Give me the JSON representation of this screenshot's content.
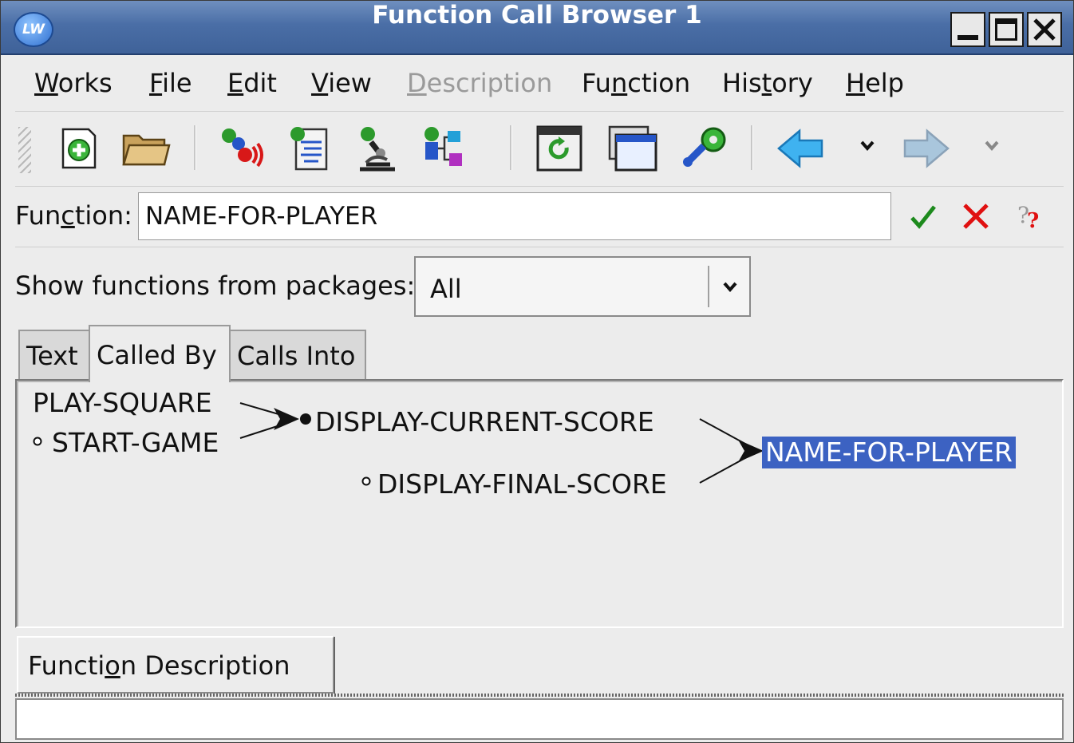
{
  "window": {
    "title": "Function Call Browser 1",
    "app_icon": "LW",
    "controls": [
      "minimize-icon",
      "maximize-icon",
      "close-icon"
    ]
  },
  "menu": {
    "items": [
      {
        "label": "Works",
        "mnemonic_index": 0,
        "enabled": true
      },
      {
        "label": "File",
        "mnemonic_index": 0,
        "enabled": true
      },
      {
        "label": "Edit",
        "mnemonic_index": 0,
        "enabled": true
      },
      {
        "label": "View",
        "mnemonic_index": 0,
        "enabled": true
      },
      {
        "label": "Description",
        "mnemonic_index": 0,
        "enabled": false
      },
      {
        "label": "Function",
        "mnemonic_index": 2,
        "enabled": true
      },
      {
        "label": "History",
        "mnemonic_index": 3,
        "enabled": true
      },
      {
        "label": "Help",
        "mnemonic_index": 0,
        "enabled": true
      }
    ]
  },
  "toolbar": {
    "buttons": [
      "new-window-icon",
      "open-folder-icon",
      "listener-icon",
      "editor-icon",
      "inspector-icon",
      "class-browser-icon",
      "refresh-icon",
      "window-icon",
      "tools-icon",
      "back-arrow-icon",
      "forward-arrow-icon"
    ]
  },
  "function_row": {
    "label": "Function:",
    "mnemonic_index": 3,
    "value": "NAME-FOR-PLAYER",
    "icons": [
      "accept-check-icon",
      "cancel-x-icon",
      "help-question-icon"
    ]
  },
  "packages_row": {
    "label": "Show functions from packages:",
    "selected": "All"
  },
  "tabs": [
    {
      "label": "Text",
      "active": false
    },
    {
      "label": "Called By",
      "active": true
    },
    {
      "label": "Calls Into",
      "active": false
    }
  ],
  "graph": {
    "nodes": [
      {
        "id": "play-square",
        "label": "PLAY-SQUARE",
        "expanded": false
      },
      {
        "id": "start-game",
        "label": "START-GAME",
        "expanded": true
      },
      {
        "id": "display-current-score",
        "label": "DISPLAY-CURRENT-SCORE",
        "expanded": false
      },
      {
        "id": "display-final-score",
        "label": "DISPLAY-FINAL-SCORE",
        "expanded": true
      },
      {
        "id": "name-for-player",
        "label": "NAME-FOR-PLAYER",
        "selected": true
      }
    ],
    "edges": [
      {
        "from": "play-square",
        "to": "display-current-score"
      },
      {
        "from": "start-game",
        "to": "display-current-score"
      },
      {
        "from": "display-current-score",
        "to": "name-for-player"
      },
      {
        "from": "display-final-score",
        "to": "name-for-player"
      }
    ]
  },
  "description_toggle": {
    "label": "Function Description >>",
    "mnemonic_index": 6
  },
  "colors": {
    "title_bar": "#4a6ea6",
    "selection": "#3c62c2",
    "accept": "#1d8a1d",
    "cancel": "#e01010"
  }
}
